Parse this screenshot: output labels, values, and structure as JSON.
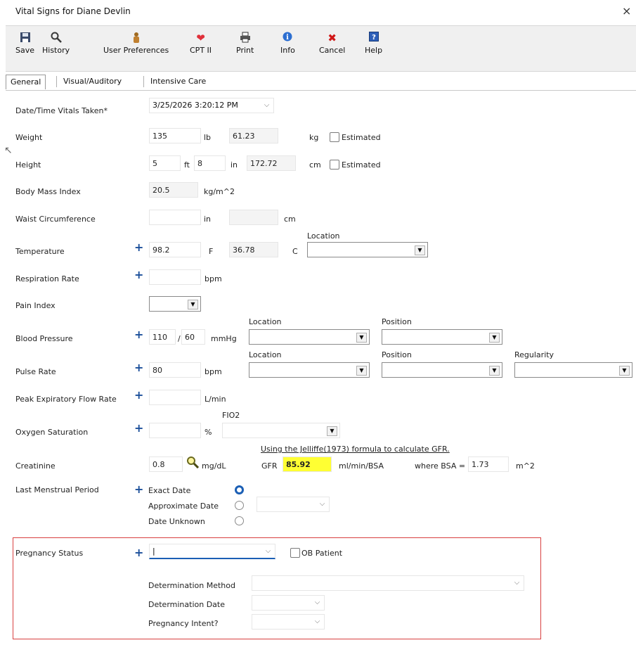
{
  "window": {
    "title": "Vital Signs for Diane Devlin",
    "close": "×"
  },
  "toolbar": {
    "save": "Save",
    "history": "History",
    "user_preferences": "User Preferences",
    "cpt2": "CPT II",
    "print": "Print",
    "info": "Info",
    "cancel": "Cancel",
    "help": "Help"
  },
  "tabs": [
    "General",
    "Visual/Auditory",
    "Intensive Care"
  ],
  "form": {
    "datetime_label": "Date/Time Vitals Taken*",
    "datetime_value": "3/25/2026 3:20:12 PM",
    "weight_label": "Weight",
    "weight_lb": "135",
    "lb_unit": "lb",
    "weight_kg": "61.23",
    "kg_unit": "kg",
    "estimated": "Estimated",
    "height_label": "Height",
    "height_ft": "5",
    "ft_unit": "ft",
    "height_in": "8",
    "in_unit": "in",
    "height_cm": "172.72",
    "cm_unit": "cm",
    "bmi_label": "Body Mass Index",
    "bmi_value": "20.5",
    "bmi_unit": "kg/m^2",
    "waist_label": "Waist Circumference",
    "waist_in_unit": "in",
    "waist_cm_unit": "cm",
    "location_header": "Location",
    "temp_label": "Temperature",
    "temp_f": "98.2",
    "f_unit": "F",
    "temp_c": "36.78",
    "c_unit": "C",
    "resp_label": "Respiration Rate",
    "bpm_unit": "bpm",
    "pain_label": "Pain Index",
    "bp_location_header": "Location",
    "bp_position_header": "Position",
    "bp_label": "Blood Pressure",
    "bp_sys": "110",
    "bp_slash": "/",
    "bp_dia": "60",
    "mmhg_unit": "mmHg",
    "pulse_location_header": "Location",
    "pulse_position_header": "Position",
    "pulse_regularity_header": "Regularity",
    "pulse_label": "Pulse Rate",
    "pulse_value": "80",
    "pulse_unit": "bpm",
    "peak_label": "Peak Expiratory Flow Rate",
    "lmin_unit": "L/min",
    "fio2_header": "FIO2",
    "o2_label": "Oxygen Saturation",
    "pct_unit": "%",
    "gfr_note": "Using the Jelliffe(1973) formula to calculate GFR.",
    "creat_label": "Creatinine",
    "creat_value": "0.8",
    "mgdl_unit": "mg/dL",
    "gfr_label": "GFR",
    "gfr_value": "85.92",
    "gfr_unit": "ml/min/BSA",
    "bsa_label": "where BSA =",
    "bsa_value": "1.73",
    "bsa_unit": "m^2",
    "lmp_label": "Last Menstrual Period",
    "exact_date": "Exact Date",
    "approx_date": "Approximate Date",
    "date_unknown": "Date Unknown",
    "preg_label": "Pregnancy Status",
    "ob_patient": "OB Patient",
    "det_method": "Determination Method",
    "det_date": "Determination Date",
    "preg_intent": "Pregnancy Intent?"
  }
}
